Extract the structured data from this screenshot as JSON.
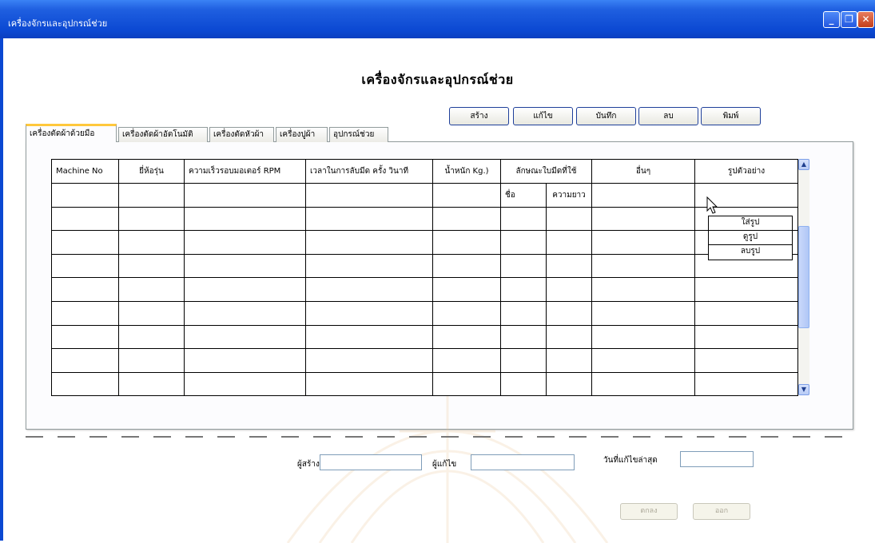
{
  "window": {
    "title": "เครื่องจักรและอุปกรณ์ช่วย",
    "controls": {
      "minimize": "minimize-icon",
      "restore": "restore-icon",
      "close": "close-icon"
    }
  },
  "page": {
    "heading": "เครื่องจักรและอุปกรณ์ช่วย"
  },
  "toolbar": {
    "create_label": "สร้าง",
    "edit_label": "แก้ไข",
    "save_label": "บันทึก",
    "delete_label": "ลบ",
    "print_label": "พิมพ์"
  },
  "tabs": [
    {
      "label": "เครื่องตัดผ้าด้วยมือ",
      "active": true
    },
    {
      "label": "เครื่องตัดผ้าอัตโนมัติ",
      "active": false
    },
    {
      "label": "เครื่องตัดหัวผ้า",
      "active": false
    },
    {
      "label": "เครื่องปูผ้า",
      "active": false
    },
    {
      "label": "อุปกรณ์ช่วย",
      "active": false
    }
  ],
  "table": {
    "columns": {
      "machine_no": "Machine No",
      "brand_model": "ยี่ห้อรุ่น",
      "motor_speed": "ความเร็วรอบมอเตอร์ RPM",
      "sharpen_time": "เวลาในการลับมีด ครั้ง วินาที",
      "weight": "น้ำหนัก Kg.)",
      "blade_type": "ลักษณะใบมีดที่ใช้",
      "blade_name": "ชื่อ",
      "blade_length": "ความยาว",
      "other": "อื่นๆ",
      "sample_image": "รูปตัวอย่าง"
    },
    "rows": [
      [
        "",
        "",
        "",
        "",
        "",
        "",
        "",
        "",
        ""
      ],
      [
        "",
        "",
        "",
        "",
        "",
        "",
        "",
        "",
        ""
      ],
      [
        "",
        "",
        "",
        "",
        "",
        "",
        "",
        "",
        ""
      ],
      [
        "",
        "",
        "",
        "",
        "",
        "",
        "",
        "",
        ""
      ],
      [
        "",
        "",
        "",
        "",
        "",
        "",
        "",
        "",
        ""
      ],
      [
        "",
        "",
        "",
        "",
        "",
        "",
        "",
        "",
        ""
      ],
      [
        "",
        "",
        "",
        "",
        "",
        "",
        "",
        "",
        ""
      ],
      [
        "",
        "",
        "",
        "",
        "",
        "",
        "",
        "",
        ""
      ]
    ]
  },
  "context_menu": {
    "items": [
      "ใส่รูป",
      "ดูรูป",
      "ลบรูป"
    ]
  },
  "footer": {
    "creator_label": "ผู้สร้าง",
    "creator_value": "",
    "editor_label": "ผู้แก้ไข",
    "editor_value": "",
    "last_edit_label": "วันที่แก้ไขล่าสุด",
    "last_edit_value": "",
    "ok_label": "ตกลง",
    "exit_label": "ออก"
  },
  "colors": {
    "titlebar": "#0b48d2",
    "active_tab_accent": "#ffc83c",
    "button_border": "#1e3f9a"
  }
}
